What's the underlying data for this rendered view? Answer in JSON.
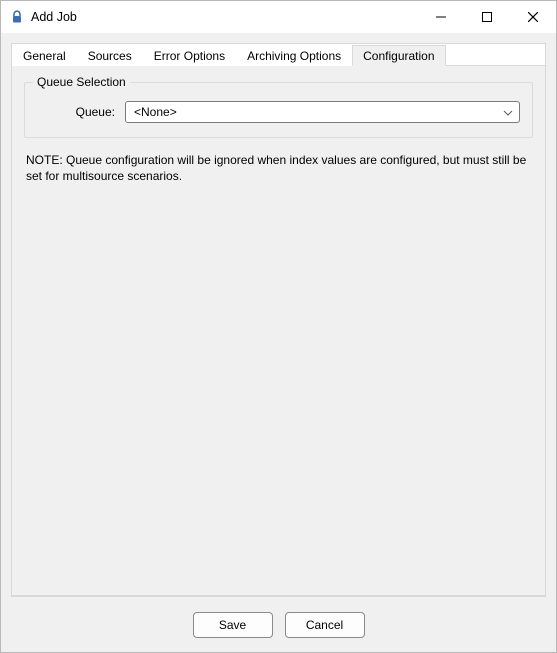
{
  "window": {
    "title": "Add Job"
  },
  "tabs": {
    "general": "General",
    "sources": "Sources",
    "error_options": "Error Options",
    "archiving_options": "Archiving Options",
    "configuration": "Configuration"
  },
  "group": {
    "legend": "Queue Selection",
    "queue_label": "Queue:",
    "queue_value": "<None>"
  },
  "note": "NOTE: Queue configuration will be ignored when index values are configured, but must still be set for multisource scenarios.",
  "buttons": {
    "save": "Save",
    "cancel": "Cancel"
  }
}
